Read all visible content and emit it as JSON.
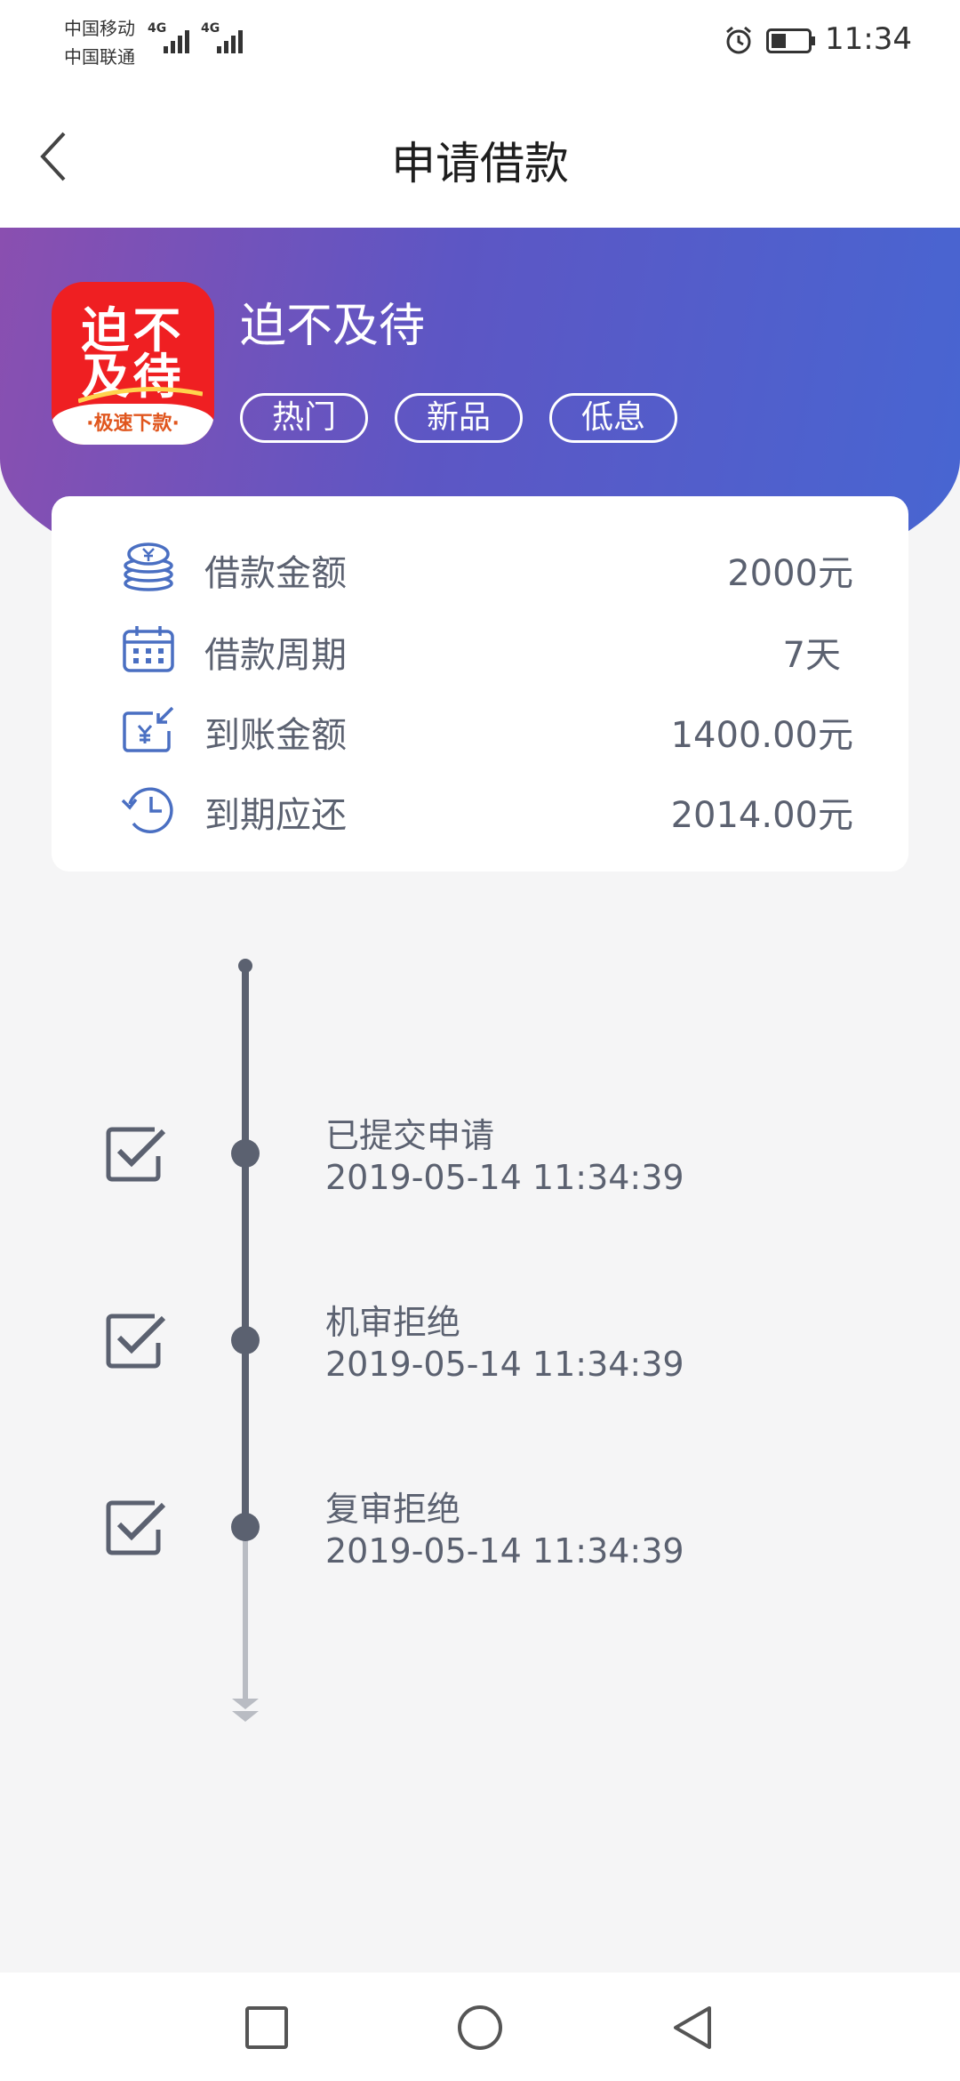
{
  "status_bar": {
    "carrier_1": "中国移动",
    "carrier_2": "中国联通",
    "network_1": "4G",
    "network_2": "4G",
    "time": "11:34",
    "icons": [
      "signal-icon",
      "alarm-icon",
      "battery-icon"
    ]
  },
  "nav": {
    "title": "申请借款",
    "back_icon": "chevron-left-icon"
  },
  "product": {
    "logo_line1": "迫不",
    "logo_line2": "及待",
    "logo_footer": "·极速下款·",
    "name": "迫不及待",
    "tags": [
      "热门",
      "新品",
      "低息"
    ],
    "logo_color": "#ef1f22"
  },
  "loan_info": [
    {
      "icon": "coins-icon",
      "label": "借款金额",
      "value": "2000元"
    },
    {
      "icon": "calendar-icon",
      "label": "借款周期",
      "value": "7天"
    },
    {
      "icon": "yuan-receive-icon",
      "label": "到账金额",
      "value": "1400.00元"
    },
    {
      "icon": "clock-return-icon",
      "label": "到期应还",
      "value": "2014.00元"
    }
  ],
  "timeline": [
    {
      "title": "已提交申请",
      "time": "2019-05-14 11:34:39",
      "checked": true
    },
    {
      "title": "机审拒绝",
      "time": "2019-05-14 11:34:39",
      "checked": true
    },
    {
      "title": "复审拒绝",
      "time": "2019-05-14 11:34:39",
      "checked": true
    }
  ],
  "system_nav": [
    "square-icon",
    "circle-icon",
    "triangle-back-icon"
  ],
  "colors": {
    "hero_start": "#8a4fb0",
    "hero_end": "#4766d2",
    "icon_blue": "#4a6fc2",
    "text_gray": "#5b6170"
  }
}
